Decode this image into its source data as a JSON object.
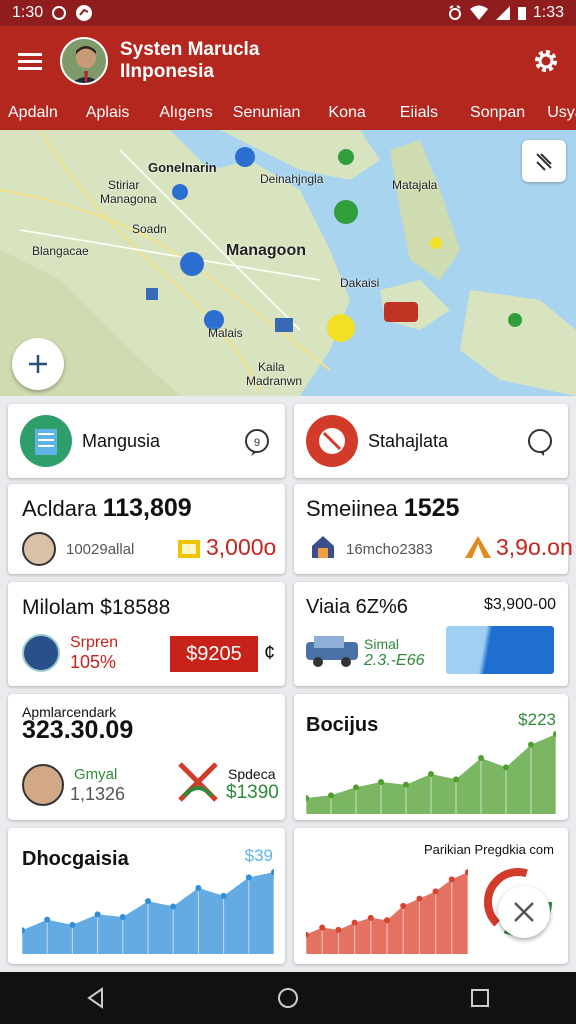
{
  "status_bar": {
    "time_left": "1:30",
    "time_right": "1:33"
  },
  "app_bar": {
    "title_line1": "Systen Marucla",
    "title_line2": "IInponesia"
  },
  "tabs": [
    "Apdaln",
    "Aplais",
    "Alıgens",
    "Senunian",
    "Kona",
    "Eiials",
    "Sonpan",
    "Usyatr"
  ],
  "map": {
    "labels": [
      "Gonelnarin",
      "Stiriar",
      "Managona",
      "Soadn",
      "Deinahjngla",
      "Matajala",
      "Blangacae",
      "Managoon",
      "Dakaisi",
      "Malais",
      "Kaila",
      "Madranwn"
    ]
  },
  "cards": {
    "c1": {
      "title": "Mangusia",
      "color": "#2e9e6a"
    },
    "c2": {
      "title": "Stahajlata",
      "color": "#d23a2a"
    },
    "c3": {
      "name": "Acldara",
      "value": "113,809",
      "sub": "10029allal",
      "amount": "3,000o"
    },
    "c4": {
      "name": "Smeiinea",
      "value": "1525",
      "sub": "16mcho2383",
      "amount": "3,9o.on"
    },
    "c5": {
      "title": "Milolam $18588",
      "label": "Srpren",
      "pct": "105%",
      "badge": "$9205",
      "suffix": "¢"
    },
    "c6": {
      "title": "Viaia 6Z%6",
      "amount": "$3,900-00",
      "label": "Simal",
      "value": "2.3.-E66"
    },
    "c7": {
      "caption": "Apmlarcendark",
      "value": "323.30.09",
      "g_label": "Gmyal",
      "g_value": "1,1326",
      "s_label": "Spdeca",
      "s_value": "$1390"
    },
    "c8": {
      "title": "Bocijus",
      "amount": "$223"
    },
    "c9": {
      "title": "Dhocgaisia",
      "amount": "$39"
    },
    "c10": {
      "caption": "Parikian Pregdkia com"
    }
  },
  "chart_data": [
    {
      "type": "area",
      "name": "Bocijus",
      "values": [
        12,
        14,
        20,
        24,
        22,
        30,
        26,
        42,
        35,
        52,
        60
      ],
      "color": "#4f9e2f"
    },
    {
      "type": "area",
      "name": "Dhocgaisia",
      "values": [
        18,
        26,
        22,
        30,
        28,
        40,
        36,
        50,
        44,
        58,
        62
      ],
      "color": "#2f8fd8"
    },
    {
      "type": "area",
      "name": "Parikian",
      "values": [
        16,
        22,
        20,
        26,
        30,
        28,
        40,
        46,
        52,
        62,
        68
      ],
      "color": "#d9432f"
    }
  ]
}
